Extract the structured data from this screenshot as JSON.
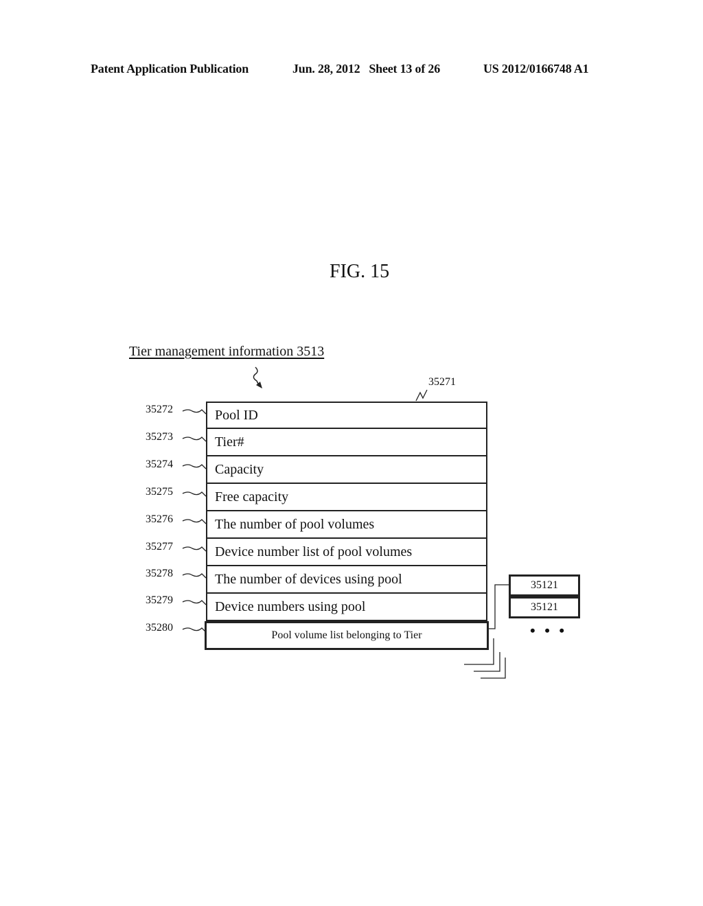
{
  "header": {
    "publication": "Patent Application Publication",
    "date_sheet": "Jun. 28, 2012   Sheet 13 of 26",
    "number": "US 2012/0166748 A1"
  },
  "figure": {
    "title": "FIG. 15",
    "caption": "Tier management information 3513",
    "table_ref": "35271",
    "rows": [
      {
        "ref": "35272",
        "label": "Pool ID"
      },
      {
        "ref": "35273",
        "label": "Tier#"
      },
      {
        "ref": "35274",
        "label": "Capacity"
      },
      {
        "ref": "35275",
        "label": "Free capacity"
      },
      {
        "ref": "35276",
        "label": "The number of pool volumes"
      },
      {
        "ref": "35277",
        "label": "Device number list of pool volumes"
      },
      {
        "ref": "35278",
        "label": "The number of devices using pool"
      },
      {
        "ref": "35279",
        "label": "Device numbers using pool"
      },
      {
        "ref": "35280",
        "label": "Pool volume list belonging to Tier"
      }
    ],
    "sub_entries": [
      "35121",
      "35121"
    ],
    "ellipsis": "• • •"
  }
}
